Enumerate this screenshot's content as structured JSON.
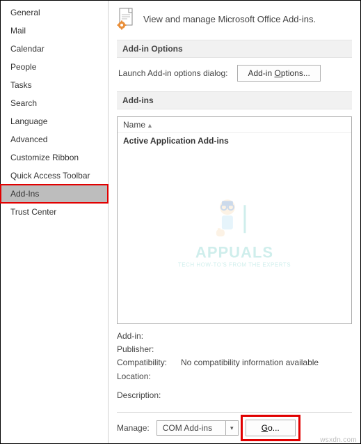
{
  "sidebar": {
    "items": [
      {
        "label": "General"
      },
      {
        "label": "Mail"
      },
      {
        "label": "Calendar"
      },
      {
        "label": "People"
      },
      {
        "label": "Tasks"
      },
      {
        "label": "Search"
      },
      {
        "label": "Language"
      },
      {
        "label": "Advanced"
      },
      {
        "label": "Customize Ribbon"
      },
      {
        "label": "Quick Access Toolbar"
      },
      {
        "label": "Add-Ins",
        "selected": true
      },
      {
        "label": "Trust Center"
      }
    ]
  },
  "header": {
    "title": "View and manage Microsoft Office Add-ins."
  },
  "options_section": {
    "title": "Add-in Options",
    "launch_label": "Launch Add-in options dialog:",
    "button_prefix": "Add-in ",
    "button_accel": "O",
    "button_suffix": "ptions..."
  },
  "addins_section": {
    "title": "Add-ins",
    "column_header": "Name",
    "group_title": "Active Application Add-ins"
  },
  "details": {
    "addin_label": "Add-in:",
    "addin_value": "",
    "publisher_label": "Publisher:",
    "publisher_value": "",
    "compat_label": "Compatibility:",
    "compat_value": "No compatibility information available",
    "location_label": "Location:",
    "location_value": "",
    "description_label": "Description:",
    "description_value": ""
  },
  "manage": {
    "label_prefix": "Mana",
    "label_accel": "g",
    "label_suffix": "e:",
    "selected": "COM Add-ins",
    "go_accel": "G",
    "go_suffix": "o..."
  },
  "watermark": {
    "brand": "APPUALS",
    "tagline": "TECH HOW-TO'S FROM THE EXPERTS"
  },
  "footer_mark": "wsxdn.com"
}
